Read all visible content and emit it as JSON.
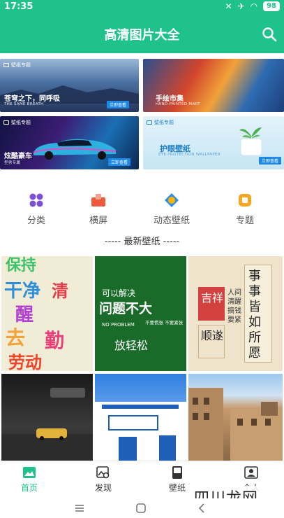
{
  "status": {
    "time": "17:35",
    "battery": "98"
  },
  "header": {
    "title": "高清图片大全"
  },
  "banners": [
    {
      "tag": "壁纸专题",
      "title": "苍穹之下，同呼吸",
      "subtitle": "THE SAME BREATH",
      "button": "立即查看"
    },
    {
      "tag": "壁纸专题",
      "title": "手绘市集",
      "subtitle": "HAND-PAINTED MART",
      "button": "立即查看"
    },
    {
      "tag": "壁纸专题",
      "title": "炫酷豪车",
      "subtitle": "型男专属",
      "button": "立即查看"
    },
    {
      "tag": "壁纸专题",
      "title": "护眼壁纸",
      "subtitle": "EYE PROTECTION WALLPAPER",
      "button": "立即查看"
    }
  ],
  "categories": [
    {
      "label": "分类",
      "icon": "grid-icon",
      "color": "#7b4fd6"
    },
    {
      "label": "横屏",
      "icon": "landscape-icon",
      "color": "#ef5a3c"
    },
    {
      "label": "动态壁纸",
      "icon": "animated-icon",
      "color": "#2f8cf0"
    },
    {
      "label": "专题",
      "icon": "topic-icon",
      "color": "#f5a623"
    }
  ],
  "section": {
    "title": "----- 最新壁纸 -----"
  },
  "wallpapers": [
    {
      "text": "保持 干净 清醒 去勤"
    },
    {
      "text": "可以解决",
      "line2": "问题不大",
      "line3": "NO PROBLEM",
      "line4": "不要慌张 不要紧张",
      "line5": "放轻松"
    },
    {
      "text": "事事皆如所愿",
      "line2": "吉祥",
      "line3": "顺遂",
      "line4": "人间清醒搞钱要紧"
    },
    {
      "text": ""
    },
    {
      "text": ""
    },
    {
      "text": ""
    }
  ],
  "bottom_nav": [
    {
      "label": "首页",
      "icon": "image-icon",
      "active": true
    },
    {
      "label": "发现",
      "icon": "discover-icon",
      "active": false
    },
    {
      "label": "壁纸",
      "icon": "wallpaper-icon",
      "active": false
    },
    {
      "label": "个人",
      "icon": "person-icon",
      "active": false
    }
  ],
  "watermark": "四川龙网",
  "colors": {
    "primary": "#1ec28a"
  }
}
